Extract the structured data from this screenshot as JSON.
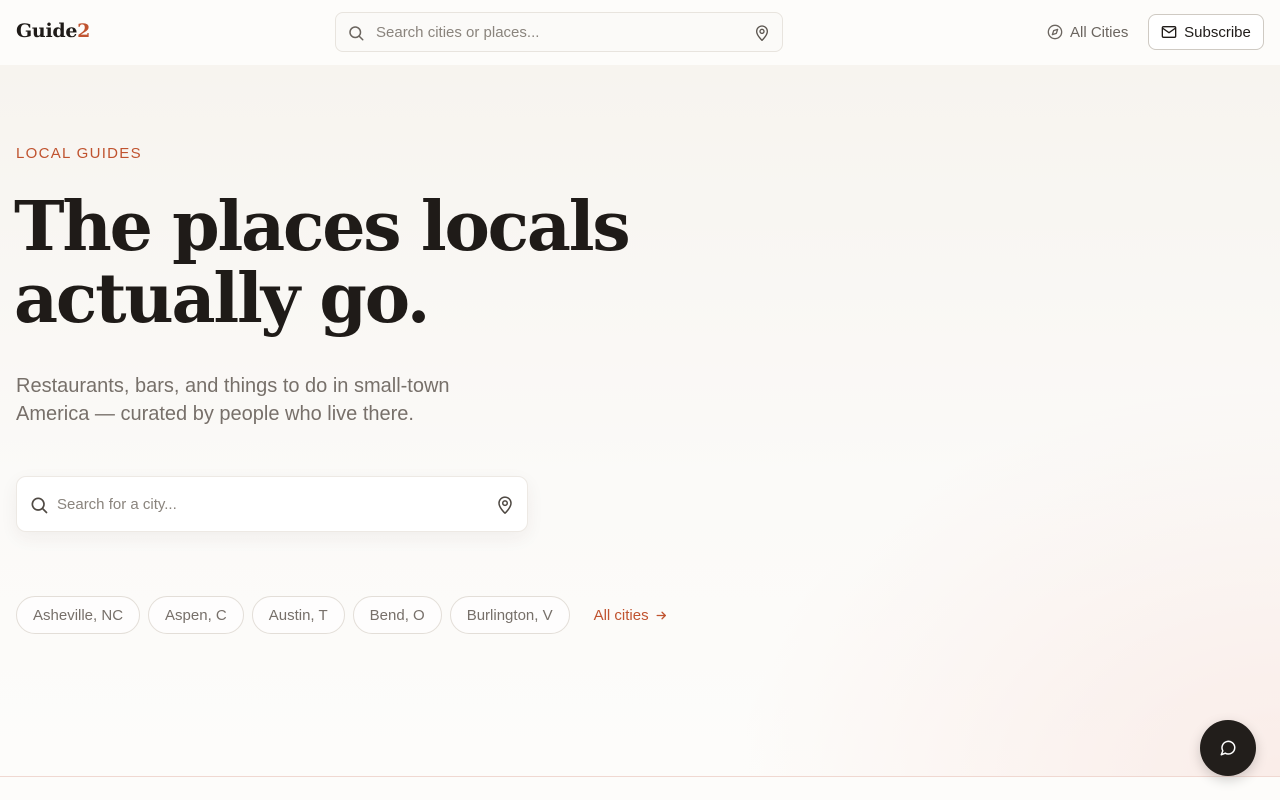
{
  "header": {
    "logo_text": "Guide",
    "logo_accent": "2",
    "search_placeholder": "Search cities or places...",
    "nav_all_cities": "All Cities",
    "subscribe_label": "Subscribe"
  },
  "hero": {
    "eyebrow": "LOCAL GUIDES",
    "headline_line1": "The places locals",
    "headline_line2": "actually go.",
    "subtitle": "Restaurants, bars, and things to do in small-town America — curated by people who live there.",
    "city_search_placeholder": "Search for a city...",
    "cities": [
      "Asheville, NC",
      "Aspen, C",
      "Austin, T",
      "Bend, O",
      "Burlington, V"
    ],
    "all_cities_link": "All cities"
  },
  "icons": {
    "search": "search-icon",
    "location": "map-pin-icon",
    "compass": "compass-icon",
    "mail": "mail-icon",
    "arrow": "arrow-right-icon",
    "chat": "chat-bubble-icon"
  },
  "colors": {
    "accent": "#c0532f",
    "text": "#1f1b18",
    "muted": "#77706a",
    "fab": "#221e1b"
  }
}
